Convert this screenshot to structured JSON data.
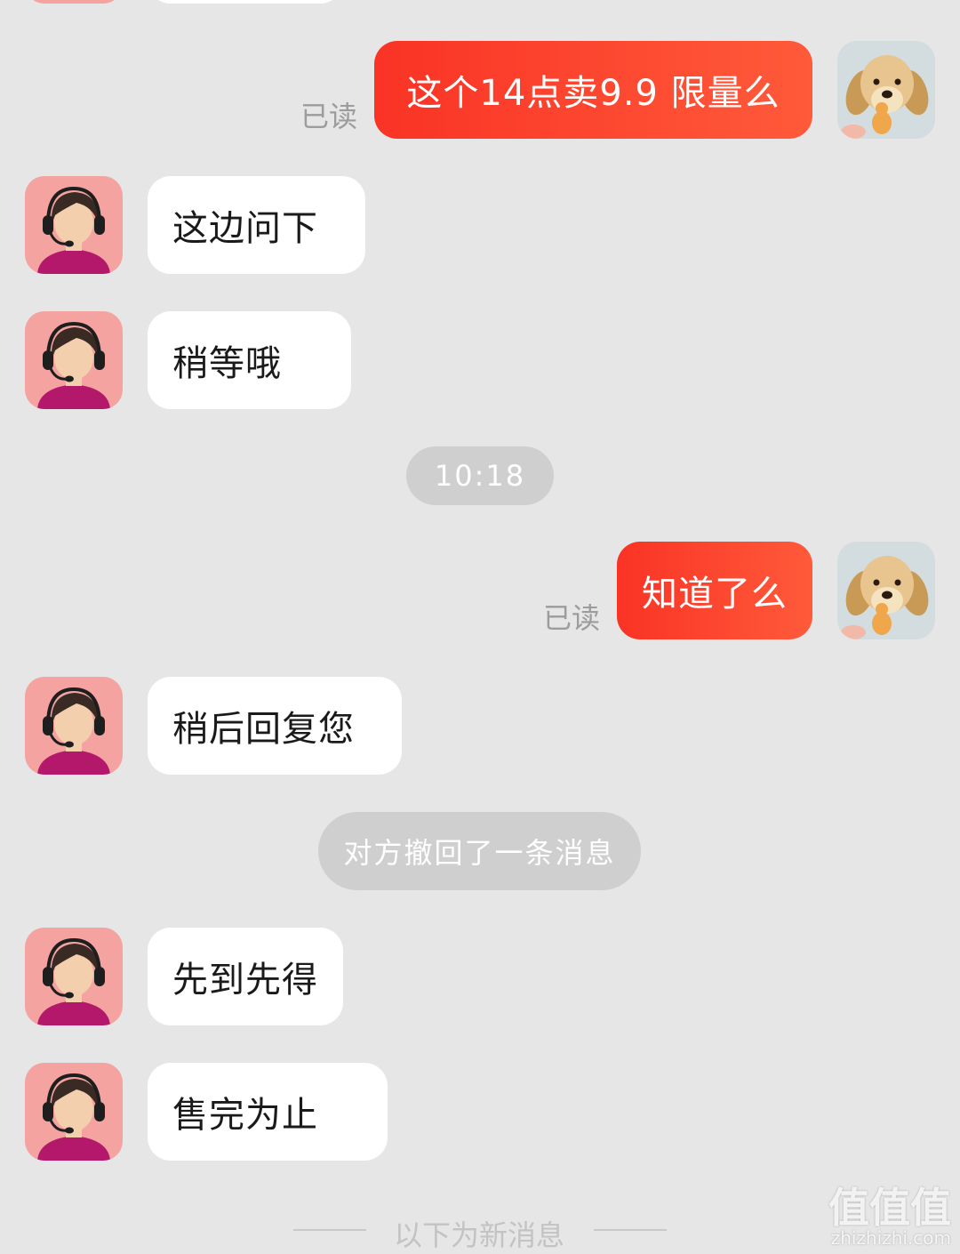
{
  "messages": [
    {
      "side": "out",
      "text": "这个14点卖9.9  限量么",
      "status": "已读"
    },
    {
      "side": "in",
      "text": "这边问下"
    },
    {
      "side": "in",
      "text": "稍等哦"
    },
    {
      "side": "out",
      "text": "知道了么",
      "status": "已读"
    },
    {
      "side": "in",
      "text": "稍后回复您"
    },
    {
      "side": "in",
      "text": "先到先得"
    },
    {
      "side": "in",
      "text": "售完为止"
    }
  ],
  "timestamp": "10:18",
  "recall_notice": "对方撤回了一条消息",
  "new_messages_divider": "以下为新消息",
  "watermark": {
    "logo": "值值值",
    "site": "zhizhizhi.com"
  },
  "colors": {
    "background": "#e6e6e6",
    "outgoing_bubble_start": "#fa3325",
    "outgoing_bubble_end": "#ff5a3a",
    "incoming_bubble": "#ffffff",
    "pill": "#cfcfcf",
    "agent_avatar_bg": "#f4a3a0"
  },
  "icons": {
    "agent_avatar": "customer-service-agent-icon",
    "user_avatar": "golden-retriever-photo"
  }
}
